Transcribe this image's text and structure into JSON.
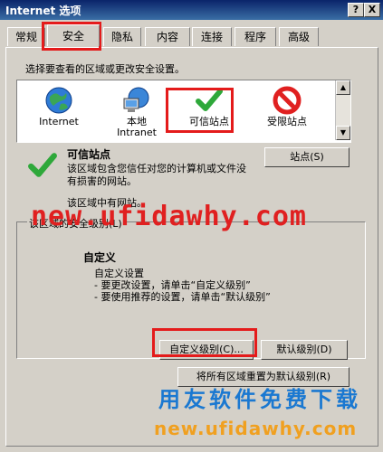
{
  "window": {
    "title": "Internet 选项",
    "help_label": "?",
    "close_label": "X"
  },
  "tabs": [
    {
      "label": "常规"
    },
    {
      "label": "安全"
    },
    {
      "label": "隐私"
    },
    {
      "label": "内容"
    },
    {
      "label": "连接"
    },
    {
      "label": "程序"
    },
    {
      "label": "高级"
    }
  ],
  "security": {
    "prompt": "选择要查看的区域或更改安全设置。",
    "zones": [
      {
        "label": "Internet",
        "icon": "globe-icon"
      },
      {
        "label": "本地\nIntranet",
        "icon": "intranet-icon"
      },
      {
        "label": "可信站点",
        "icon": "checkmark-icon"
      },
      {
        "label": "受限站点",
        "icon": "restricted-icon"
      }
    ],
    "selected_zone_title": "可信站点",
    "selected_zone_desc": "该区域包含您信任对您的计算机或文件没有损害的网站。",
    "sites_button": "站点(S)",
    "zone_sites_note": "该区域中有网站。",
    "security_level_label": "该区域的安全级别(L)",
    "level_title": "自定义",
    "level_lines": [
      "自定义设置",
      "- 要更改设置，请单击“自定义级别”",
      "- 要使用推荐的设置，请单击“默认级别”"
    ],
    "custom_level_button": "自定义级别(C)...",
    "default_level_button": "默认级别(D)",
    "reset_all_button": "将所有区域重置为默认级别(R)"
  },
  "watermarks": {
    "url_top": "new.ufidawhy.com",
    "cn_text": "用友软件免费下载",
    "url_bottom": "new.ufidawhy.com"
  },
  "colors": {
    "highlight_box": "#e41b1b",
    "watermark_red": "#e02020",
    "watermark_blue": "#1a78d1",
    "watermark_orange": "#f0a020"
  }
}
